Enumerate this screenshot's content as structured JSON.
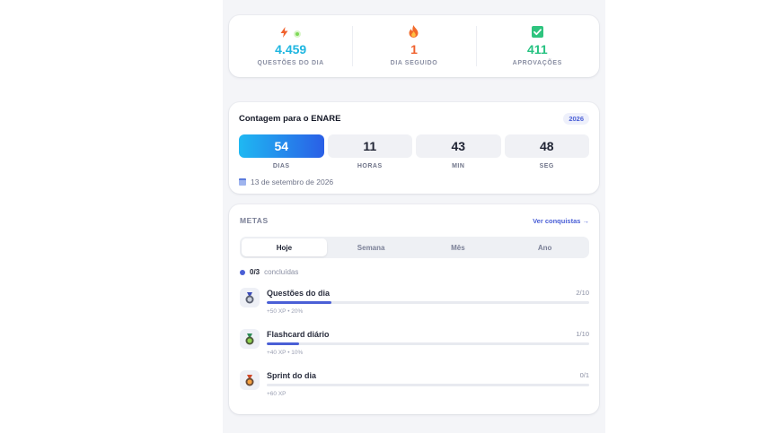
{
  "stats": [
    {
      "value": "4.459",
      "label": "QUESTÕES DO DIA",
      "icon": "bolt-icon",
      "color": "#1fb6e0"
    },
    {
      "value": "1",
      "label": "DIA SEGUIDO",
      "icon": "fire-icon",
      "color": "#f0622e"
    },
    {
      "value": "411",
      "label": "APROVAÇÕES",
      "icon": "check-square-icon",
      "color": "#26c281"
    }
  ],
  "countdown": {
    "title": "Contagem para o ENARE",
    "year": "2026",
    "units": [
      {
        "value": "54",
        "label": "DIAS"
      },
      {
        "value": "11",
        "label": "HORAS"
      },
      {
        "value": "43",
        "label": "MIN"
      },
      {
        "value": "48",
        "label": "SEG"
      }
    ],
    "date": "13 de setembro de 2026"
  },
  "goals": {
    "title": "METAS",
    "link": "Ver conquistas →",
    "tabs": [
      "Hoje",
      "Semana",
      "Mês",
      "Ano"
    ],
    "active_tab": "Hoje",
    "summary_count": "0/3",
    "summary_text": "concluídas",
    "items": [
      {
        "name": "Questões do dia",
        "count": "2/10",
        "progress": 0.2,
        "meta": "+50 XP • 20%",
        "icon": "medal-silver-icon"
      },
      {
        "name": "Flashcard diário",
        "count": "1/10",
        "progress": 0.1,
        "meta": "+40 XP • 10%",
        "icon": "medal-green-icon"
      },
      {
        "name": "Sprint do dia",
        "count": "0/1",
        "progress": 0,
        "meta": "+60 XP",
        "icon": "medal-orange-icon"
      }
    ]
  }
}
